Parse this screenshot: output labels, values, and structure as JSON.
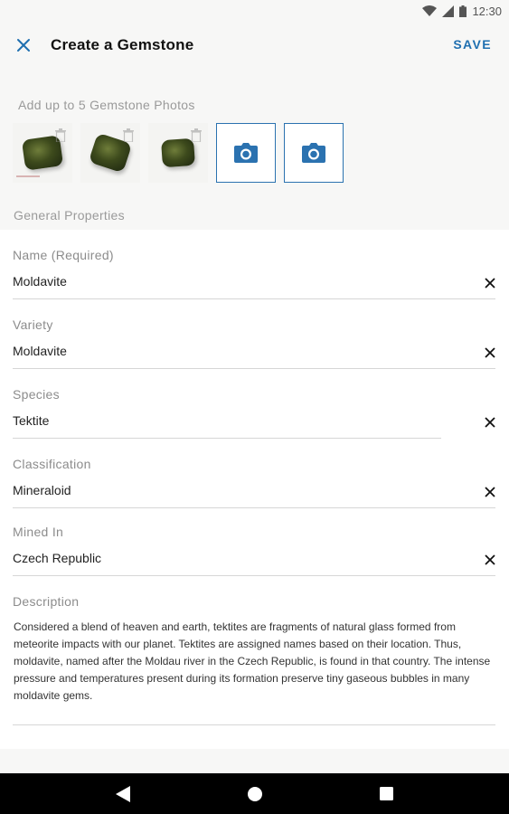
{
  "status_bar": {
    "time": "12:30",
    "icons": [
      "wifi-icon",
      "signal-icon",
      "battery-icon"
    ]
  },
  "app_bar": {
    "title": "Create a Gemstone",
    "save_label": "SAVE",
    "close_icon": "close-icon"
  },
  "photos": {
    "label": "Add up to 5 Gemstone Photos",
    "thumbnails": [
      {
        "name": "photo-1",
        "has_delete": true
      },
      {
        "name": "photo-2",
        "has_delete": true
      },
      {
        "name": "photo-3",
        "has_delete": true
      }
    ],
    "add_slots": 2,
    "add_icon": "camera-icon"
  },
  "section": {
    "label": "General Properties"
  },
  "fields": [
    {
      "label": "Name (Required)",
      "value": "Moldavite",
      "clearable": true
    },
    {
      "label": "Variety",
      "value": "Moldavite",
      "clearable": true
    },
    {
      "label": "Species",
      "value": "Tektite",
      "clearable": true
    },
    {
      "label": "Classification",
      "value": "Mineraloid",
      "clearable": true
    },
    {
      "label": "Mined In",
      "value": "Czech Republic",
      "clearable": true
    }
  ],
  "description": {
    "label": "Description",
    "value": "Considered a blend of heaven and earth, tektites are fragments of natural glass formed from meteorite impacts with our planet. Tektites are assigned names based on their location. Thus, moldavite, named after the Moldau river in the Czech Republic, is found in that country. The intense pressure and temperatures present during its formation preserve tiny gaseous bubbles in many moldavite gems."
  },
  "nav_bar": {
    "back_icon": "back-icon",
    "home_icon": "home-icon",
    "recents_icon": "recents-icon"
  },
  "colors": {
    "accent": "#1f6fb0",
    "background": "#f7f7f6",
    "card": "#ffffff",
    "label": "#8c8c8c"
  }
}
